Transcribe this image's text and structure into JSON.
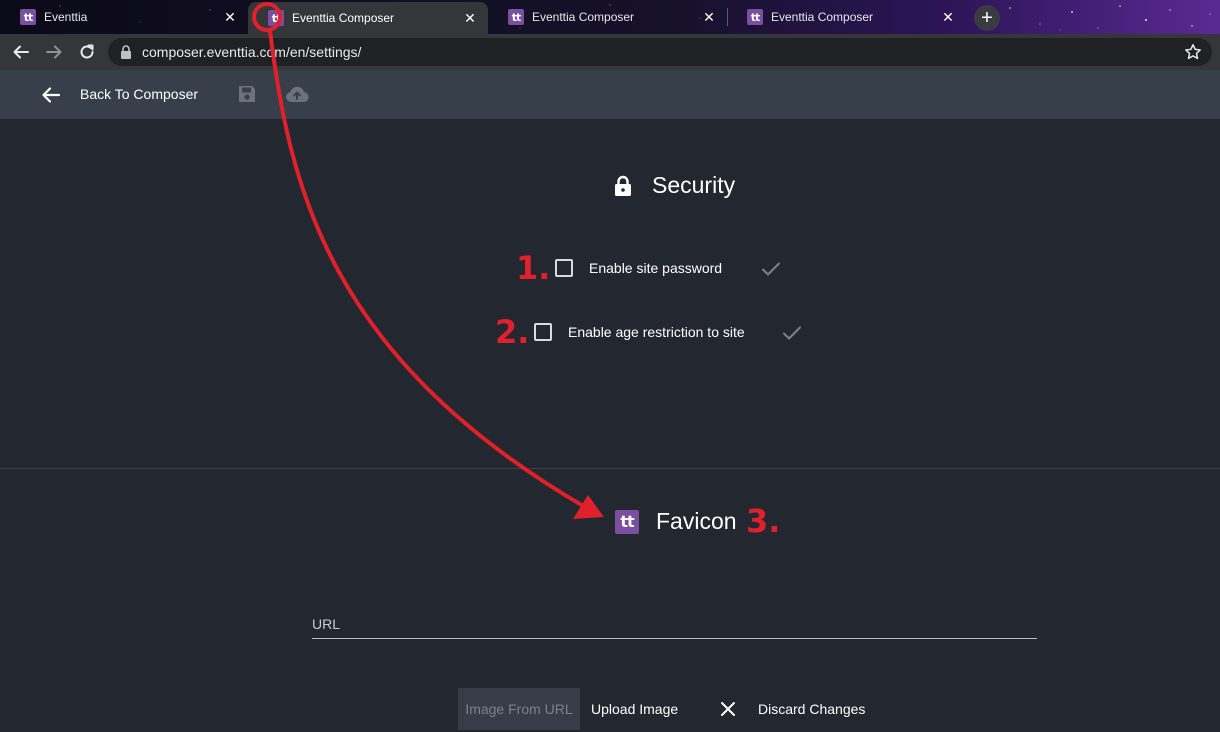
{
  "browser": {
    "tabs": [
      {
        "title": "Eventtia",
        "favicon": "tt",
        "active": false
      },
      {
        "title": "Eventtia Composer",
        "favicon": "tt",
        "active": true
      },
      {
        "title": "Eventtia Composer",
        "favicon": "tt",
        "active": false
      },
      {
        "title": "Eventtia Composer",
        "favicon": "tt",
        "active": false
      }
    ],
    "close_glyph": "✕",
    "new_tab_glyph": "+",
    "url": "composer.eventtia.com/en/settings/"
  },
  "header": {
    "back_label": "Back To Composer"
  },
  "security": {
    "title": "Security",
    "options": [
      {
        "label": "Enable site password",
        "checked": false
      },
      {
        "label": "Enable age restriction to site",
        "checked": false
      }
    ]
  },
  "favicon_section": {
    "title": "Favicon",
    "icon_text": "tt",
    "url_placeholder": "URL",
    "url_value": "",
    "buttons": {
      "image_from_url": "Image From URL",
      "upload_image": "Upload Image",
      "discard_changes": "Discard Changes"
    }
  },
  "annotations": {
    "step_1": "1.",
    "step_2": "2.",
    "step_3": "3.",
    "color": "#e0202a"
  },
  "colors": {
    "background": "#222730",
    "appbar": "#373f4b",
    "favicon_purple": "#7a4fa0"
  }
}
